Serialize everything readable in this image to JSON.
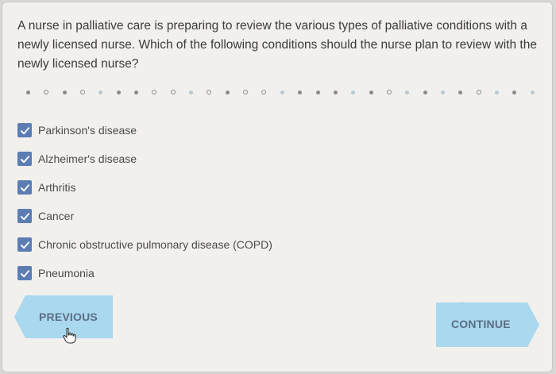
{
  "question": {
    "text": "A nurse in palliative care is preparing to review the various types of palliative conditions with a newly licensed nurse. Which of the following conditions should the nurse plan to review with the newly licensed nurse?"
  },
  "progress": {
    "dots": [
      "filled",
      "ring",
      "filled",
      "ring",
      "light",
      "filled",
      "filled",
      "ring",
      "ring",
      "light",
      "ring",
      "filled",
      "ring",
      "ring",
      "light",
      "filled",
      "filled",
      "filled",
      "light",
      "filled",
      "ring",
      "light",
      "filled",
      "light",
      "filled",
      "ring",
      "light",
      "filled",
      "light"
    ]
  },
  "options": [
    {
      "label": "Parkinson's disease",
      "checked": true
    },
    {
      "label": "Alzheimer's disease",
      "checked": true
    },
    {
      "label": "Arthritis",
      "checked": true
    },
    {
      "label": "Cancer",
      "checked": true
    },
    {
      "label": "Chronic obstructive pulmonary disease (COPD)",
      "checked": true
    },
    {
      "label": "Pneumonia",
      "checked": true
    }
  ],
  "nav": {
    "previous_label": "PREVIOUS",
    "continue_label": "CONTINUE"
  },
  "colors": {
    "checkbox": "#5b7db4",
    "button_fill": "#a9d8ef",
    "button_text": "#5a6e82",
    "card_background": "#f1f0ed"
  },
  "icons": {
    "checkbox": "checkmark-icon",
    "cursor": "hand-pointer-icon"
  }
}
